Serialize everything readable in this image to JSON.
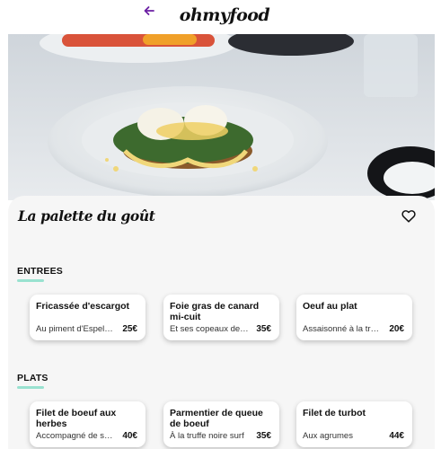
{
  "app": {
    "logo_text": "ohmyfood"
  },
  "restaurant": {
    "name": "La palette du goût"
  },
  "icons": {
    "back": "arrow-left-icon",
    "favorite": "heart-outline-icon"
  },
  "colors": {
    "accent_purple": "#6b1fa3",
    "underline_mint": "#99e2d0",
    "panel_bg": "#f6f6f6"
  },
  "sections": [
    {
      "title": "ENTREES",
      "items": [
        {
          "name": "Fricassée d'escargot",
          "desc": "Au piment d'Espelette",
          "price": "25€"
        },
        {
          "name": "Foie gras de canard mi-cuit",
          "desc": "Et ses copeaux de truffe",
          "price": "35€"
        },
        {
          "name": "Oeuf au plat",
          "desc": "Assaisonné à la truffe",
          "price": "20€"
        }
      ]
    },
    {
      "title": "PLATS",
      "items": [
        {
          "name": "Filet de boeuf aux herbes",
          "desc": "Accompagné de son gratin",
          "price": "40€"
        },
        {
          "name": "Parmentier de queue de boeuf",
          "desc": "À la truffe noire surf",
          "price": "35€"
        },
        {
          "name": "Filet de turbot",
          "desc": "Aux agrumes",
          "price": "44€"
        }
      ]
    }
  ]
}
